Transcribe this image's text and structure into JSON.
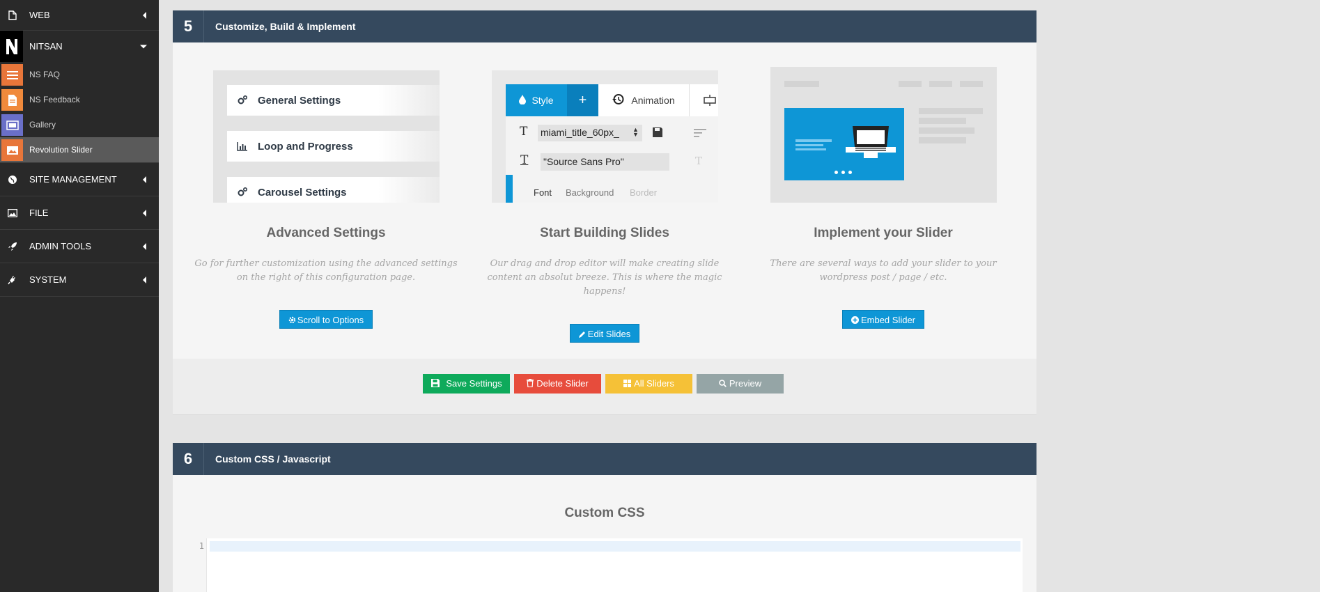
{
  "sidebar": {
    "web_label": "WEB",
    "nitsan_label": "NITSAN",
    "sub_items": [
      {
        "label": "NS FAQ",
        "color": "#e8763a"
      },
      {
        "label": "NS Feedback",
        "color": "#f08a3c"
      },
      {
        "label": "Gallery",
        "color": "#6a6fc8"
      },
      {
        "label": "Revolution Slider",
        "color": "#e8763a"
      }
    ],
    "site_management_label": "SITE MANAGEMENT",
    "file_label": "FILE",
    "admin_tools_label": "ADMIN TOOLS",
    "system_label": "SYSTEM"
  },
  "section5": {
    "number": "5",
    "title": "Customize, Build & Implement",
    "illustration1": {
      "rows": [
        "General Settings",
        "Loop and Progress",
        "Carousel Settings"
      ]
    },
    "illustration2": {
      "style_tab": "Style",
      "plus_tab": "+",
      "animation_tab": "Animation",
      "font_field_value": "miami_title_60px_",
      "font_family_value": "\"Source Sans Pro\"",
      "subtabs": [
        "Font",
        "Background",
        "Border"
      ]
    },
    "columns": [
      {
        "title": "Advanced Settings",
        "description": "Go for further customization using the advanced settings on the right of this configuration page.",
        "button": "Scroll to Options",
        "button_icon": "gear-icon"
      },
      {
        "title": "Start Building Slides",
        "description": "Our drag and drop editor will make creating slide content an absolut breeze. This is where the magic happens!",
        "button": "Edit Slides",
        "button_icon": "pencil-icon"
      },
      {
        "title": "Implement your Slider",
        "description": "There are several ways to add your slider to your wordpress post / page / etc.",
        "button": "Embed Slider",
        "button_icon": "plus-circle-icon"
      }
    ],
    "actions": {
      "save": "Save Settings",
      "delete": "Delete Slider",
      "all": "All Sliders",
      "preview": "Preview"
    },
    "colors": {
      "save": "#0eaa5b",
      "delete": "#e74c3c",
      "all": "#f5c137",
      "preview": "#95a5a6"
    }
  },
  "section6": {
    "number": "6",
    "title": "Custom CSS / Javascript",
    "css_heading": "Custom CSS",
    "line_number": "1"
  }
}
